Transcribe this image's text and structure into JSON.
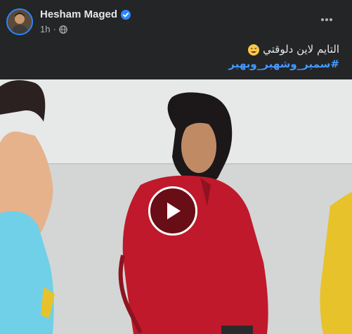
{
  "post": {
    "author": "Hesham Maged",
    "time": "1h",
    "separator": "·",
    "text_line": "التايم لاين دلوقتي",
    "hashtag": "#سمير_وشهير_وبهير"
  },
  "icons": {
    "verified": "verified-badge-icon",
    "audience": "globe-icon",
    "more": "more-options-icon",
    "emoji": "grinning-sweat-emoji-icon",
    "play": "play-icon"
  },
  "colors": {
    "background": "#242526",
    "text_primary": "#e4e6eb",
    "text_secondary": "#b0b3b8",
    "link": "#4599ff",
    "verified": "#2d88ff",
    "shirt_red": "#c0192b",
    "shirt_blue": "#6fd0e8",
    "shirt_yellow": "#e8c22a"
  },
  "video": {
    "state": "paused"
  }
}
